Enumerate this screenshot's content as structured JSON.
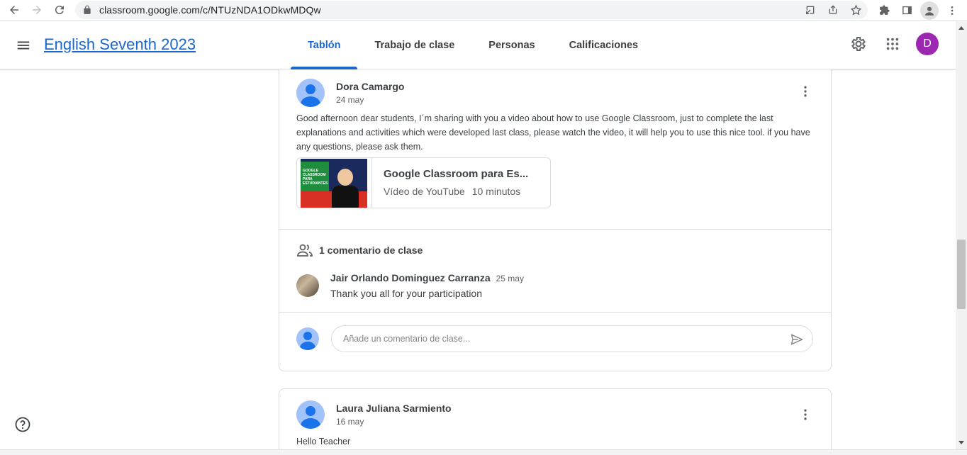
{
  "browser": {
    "url": "classroom.google.com/c/NTUzNDA1ODkwMDQw"
  },
  "header": {
    "class_title": "English Seventh 2023",
    "tabs": [
      {
        "label": "Tablón",
        "active": true
      },
      {
        "label": "Trabajo de clase",
        "active": false
      },
      {
        "label": "Personas",
        "active": false
      },
      {
        "label": "Calificaciones",
        "active": false
      }
    ],
    "user_initial": "D",
    "user_avatar_color": "#9c27b0",
    "accent_color": "#1967d2"
  },
  "posts": [
    {
      "author": "Dora Camargo",
      "date": "24 may",
      "body": "Good afternoon dear students, I´m sharing with you a video about how to use Google Classroom, just to complete the last explanations and activities which were developed last class, please watch the video, it will help you to use this nice tool.  if you have any questions, please ask them.",
      "attachment": {
        "title": "Google Classroom para Es...",
        "source": "Vídeo de YouTube",
        "duration": "10 minutos",
        "thumb_text": "GOOGLE CLASSROOM PARA ESTUDIANTES"
      },
      "comments_count_label": "1 comentario de clase",
      "comments": [
        {
          "author": "Jair Orlando Dominguez Carranza",
          "date": "25 may",
          "text": "Thank you all for your participation"
        }
      ],
      "comment_placeholder": "Añade un comentario de clase..."
    },
    {
      "author": "Laura Juliana Sarmiento",
      "date": "16 may",
      "body": "Hello Teacher"
    }
  ]
}
